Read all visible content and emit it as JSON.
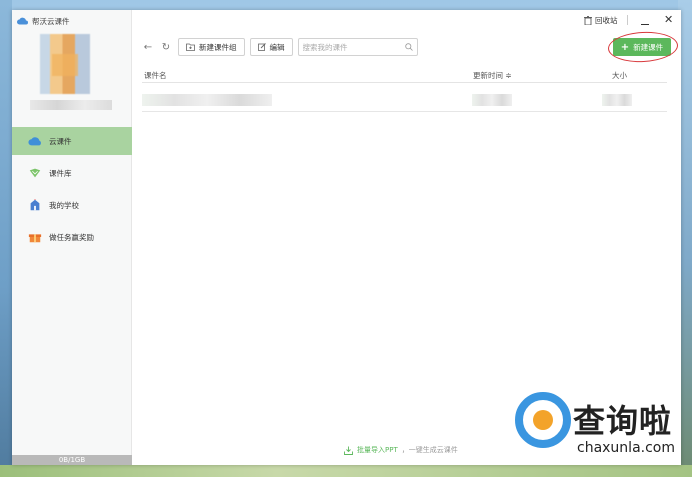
{
  "app": {
    "title": "帮沃云课件"
  },
  "sidebar": {
    "items": [
      {
        "label": "云课件",
        "icon": "cloud-icon",
        "active": true
      },
      {
        "label": "课件库",
        "icon": "library-icon",
        "active": false
      },
      {
        "label": "我的学校",
        "icon": "school-icon",
        "active": false
      },
      {
        "label": "做任务赢奖励",
        "icon": "gift-icon",
        "active": false
      }
    ],
    "storage": "0B/1GB"
  },
  "titlebar": {
    "recycle_label": "回收站"
  },
  "toolbar": {
    "new_group_label": "新建课件组",
    "edit_label": "编辑",
    "search_placeholder": "搜索我的课件",
    "new_courseware_label": "新建课件"
  },
  "table": {
    "columns": [
      "课件名",
      "更新时间",
      "大小"
    ],
    "sort_indicator": "≑"
  },
  "footer": {
    "import_label": "批量导入PPT",
    "hint": "，一键生成云课件"
  },
  "watermark": {
    "text": "查询啦",
    "sub": "chaxunla.com"
  },
  "colors": {
    "accent_green": "#5cb85c",
    "active_nav": "#a9d3a0",
    "annotation_red": "#d8383b"
  }
}
